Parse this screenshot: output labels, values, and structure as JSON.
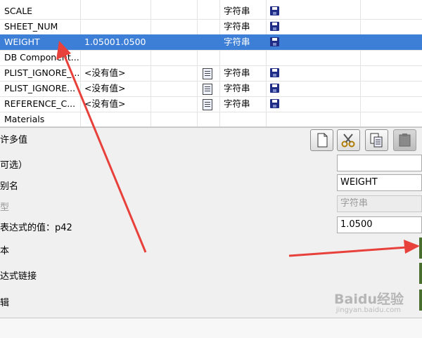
{
  "table": {
    "rows": [
      {
        "name": "SCALE",
        "value": "",
        "type": "字符串",
        "has_doc": false,
        "selected": false
      },
      {
        "name": "SHEET_NUM",
        "value": "",
        "type": "字符串",
        "has_doc": false,
        "selected": false
      },
      {
        "name": "WEIGHT",
        "value": "1.05001.0500",
        "type": "字符串",
        "has_doc": false,
        "selected": true
      },
      {
        "name": "DB Component...",
        "value": "",
        "type": "",
        "has_doc": false,
        "selected": false
      },
      {
        "name": "PLIST_IGNORE_...",
        "value": "<没有值>",
        "type": "字符串",
        "has_doc": true,
        "selected": false
      },
      {
        "name": "PLIST_IGNORE...",
        "value": "<没有值>",
        "type": "字符串",
        "has_doc": true,
        "selected": false
      },
      {
        "name": "REFERENCE_C...",
        "value": "<没有值>",
        "type": "字符串",
        "has_doc": true,
        "selected": false
      },
      {
        "name": "Materials",
        "value": "",
        "type": "",
        "has_doc": false,
        "selected": false
      }
    ]
  },
  "panel": {
    "label_multi": "许多值",
    "label_optional": "可选）",
    "label_name": "别名",
    "label_type": "型",
    "label_expr": "表达式的值：p42",
    "label_text": "本",
    "label_link": "达式链接",
    "label_edit": "辑",
    "field_optional": "",
    "field_name": "WEIGHT",
    "field_type": "字符串",
    "field_expr": "1.0500"
  },
  "toolbar": {
    "icons": [
      "new-doc-icon",
      "scissors-icon",
      "copy-icon",
      "paste-icon"
    ]
  },
  "watermark": {
    "text": "Baidu经验",
    "sub": "jingyan.baidu.com"
  },
  "colors": {
    "selection": "#3d7fd6",
    "arrow": "#e8413c",
    "save_icon": "#1f2d86"
  }
}
